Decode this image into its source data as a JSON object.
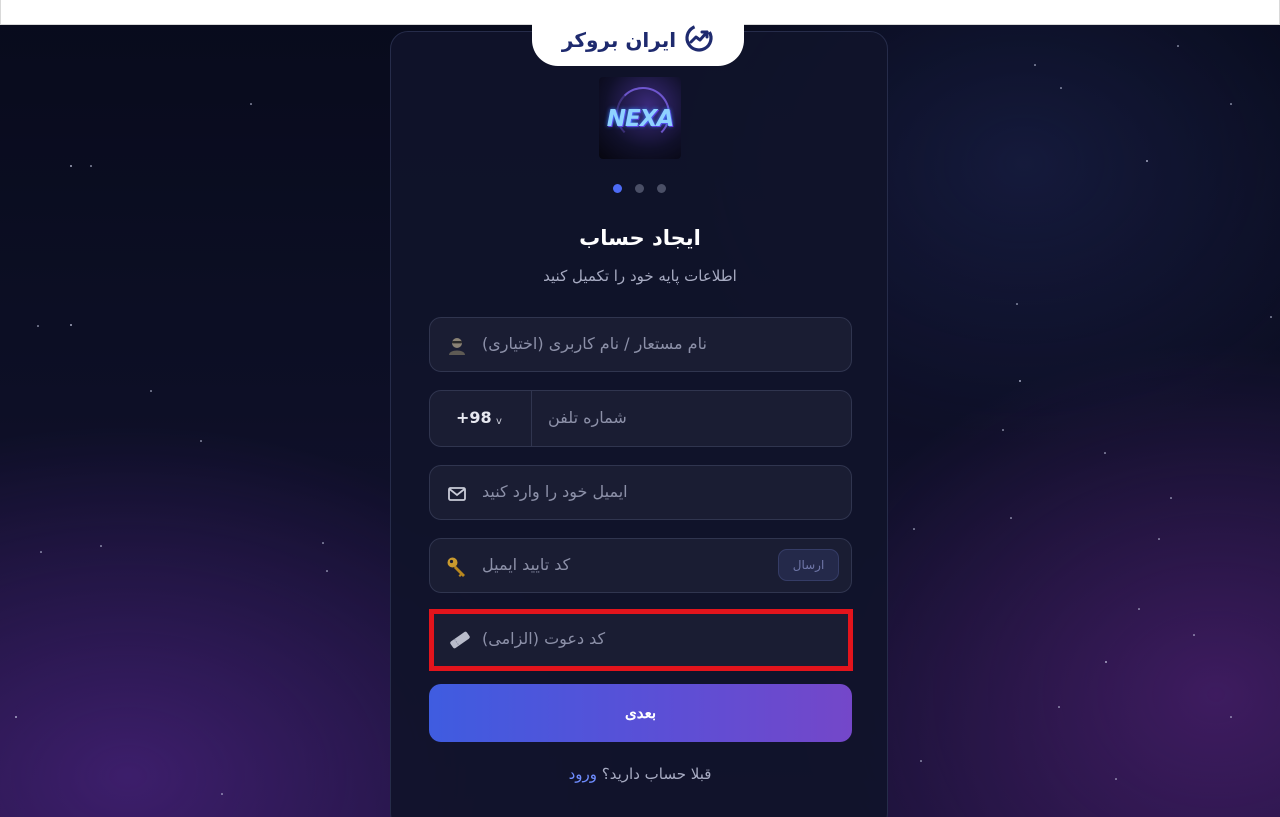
{
  "brand": {
    "name": "ایران بروکر"
  },
  "logo": {
    "text": "NEXA"
  },
  "steps": {
    "total": 3,
    "current": 1
  },
  "header": {
    "title": "ایجاد حساب",
    "subtitle": "اطلاعات پایه خود را تکمیل کنید"
  },
  "form": {
    "username": {
      "placeholder": "نام مستعار / نام کاربری (اختیاری)",
      "icon": "user-icon"
    },
    "phone": {
      "country_code": "+98",
      "placeholder": "شماره تلفن",
      "chevron": "v"
    },
    "email": {
      "placeholder": "ایمیل خود را وارد کنید",
      "icon": "mail-icon"
    },
    "email_code": {
      "placeholder": "کد تایید ایمیل",
      "icon": "key-icon",
      "send_label": "ارسال"
    },
    "invite_code": {
      "placeholder": "کد دعوت (الزامی)",
      "icon": "ticket-icon"
    },
    "next_label": "بعدی"
  },
  "footer": {
    "question": "قبلا حساب دارید؟",
    "login_link": "ورود"
  },
  "colors": {
    "accent": "#4d6bf5",
    "highlight": "#e3141c"
  }
}
